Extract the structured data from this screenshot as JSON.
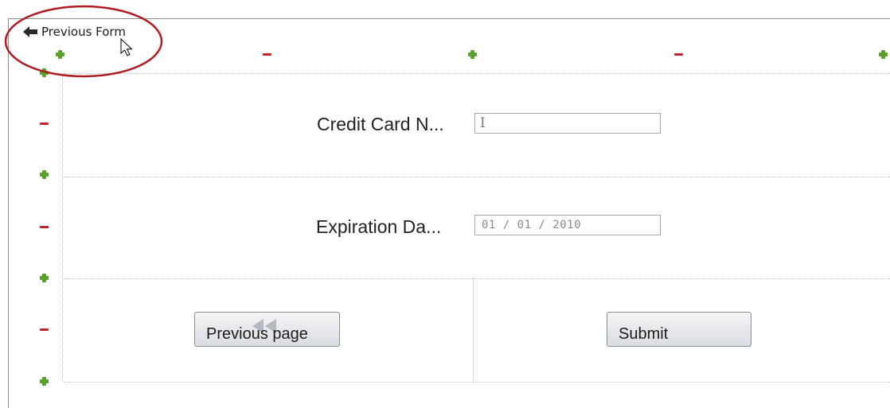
{
  "nav": {
    "back_label": "Previous Form",
    "back_icon": "arrow-left-icon"
  },
  "annotation": {
    "ellipse_color": "#b01c22"
  },
  "form": {
    "credit_card": {
      "label": "Credit Card N...",
      "value": ""
    },
    "expiration": {
      "label": "Expiration Da...",
      "value": "01 / 01 / 2010"
    }
  },
  "buttons": {
    "previous": {
      "label": "Previous page",
      "icon": "rewind-icon"
    },
    "submit": {
      "label": "Submit"
    }
  },
  "colors": {
    "add_row_col": "#5aa02c",
    "remove_row_col": "#c0232b",
    "grid": "#c6c6c6"
  }
}
